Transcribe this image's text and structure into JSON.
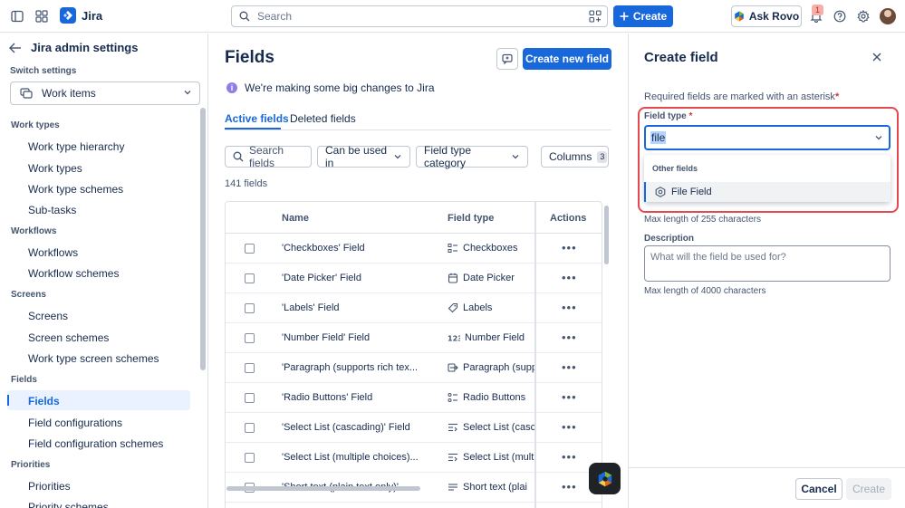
{
  "app": {
    "name": "Jira"
  },
  "search": {
    "placeholder": "Search"
  },
  "topbar": {
    "create_label": "Create",
    "ask_rovo_label": "Ask Rovo",
    "notification_count": "1"
  },
  "sidebar": {
    "back_label": "Jira admin settings",
    "switch_label": "Switch settings",
    "switch_value": "Work items",
    "sections": [
      {
        "title": "Work types",
        "items": [
          "Work type hierarchy",
          "Work types",
          "Work type schemes",
          "Sub-tasks"
        ]
      },
      {
        "title": "Workflows",
        "items": [
          "Workflows",
          "Workflow schemes"
        ]
      },
      {
        "title": "Screens",
        "items": [
          "Screens",
          "Screen schemes",
          "Work type screen schemes"
        ]
      },
      {
        "title": "Fields",
        "items": [
          "Fields",
          "Field configurations",
          "Field configuration schemes"
        ]
      },
      {
        "title": "Priorities",
        "items": [
          "Priorities",
          "Priority schemes"
        ]
      }
    ],
    "active_item": "Fields"
  },
  "main": {
    "title": "Fields",
    "create_new_field_label": "Create new field",
    "notice": "We're making some big changes to Jira",
    "tabs": [
      {
        "label": "Active fields",
        "active": true
      },
      {
        "label": "Deleted fields",
        "active": false
      }
    ],
    "filters": {
      "search_placeholder": "Search fields",
      "can_be_used_in": "Can be used in",
      "field_type_category": "Field type category",
      "columns_label": "Columns",
      "columns_count": "3"
    },
    "count_label": "141 fields",
    "table": {
      "headers": {
        "name": "Name",
        "field_type": "Field type",
        "actions": "Actions"
      },
      "rows": [
        {
          "name": "'Checkboxes' Field",
          "type": "Checkboxes",
          "icon": "checkbox-list-icon"
        },
        {
          "name": "'Date Picker' Field",
          "type": "Date Picker",
          "icon": "calendar-icon"
        },
        {
          "name": "'Labels' Field",
          "type": "Labels",
          "icon": "tag-icon"
        },
        {
          "name": "'Number Field' Field",
          "type": "Number Field",
          "icon": "number-icon"
        },
        {
          "name": "'Paragraph (supports rich tex...",
          "type": "Paragraph (supp",
          "icon": "paragraph-icon"
        },
        {
          "name": "'Radio Buttons' Field",
          "type": "Radio Buttons",
          "icon": "radio-list-icon"
        },
        {
          "name": "'Select List (cascading)' Field",
          "type": "Select List (casc",
          "icon": "select-list-icon"
        },
        {
          "name": "'Select List (multiple choices)...",
          "type": "Select List (mult",
          "icon": "select-list-icon"
        },
        {
          "name": "'Short text (plain text only)'",
          "type": "Short text (plai",
          "icon": "text-icon"
        }
      ]
    }
  },
  "panel": {
    "title": "Create field",
    "required_note": "Required fields are marked with an asterisk",
    "asterisk": "*",
    "field_type_label": "Field type",
    "field_type_value": "file",
    "dropdown": {
      "group": "Other fields",
      "option": "File Field"
    },
    "name_hint": "Max length of 255 characters",
    "description_label": "Description",
    "description_placeholder": "What will the field be used for?",
    "description_hint": "Max length of 4000 characters",
    "cancel_label": "Cancel",
    "create_label": "Create"
  }
}
